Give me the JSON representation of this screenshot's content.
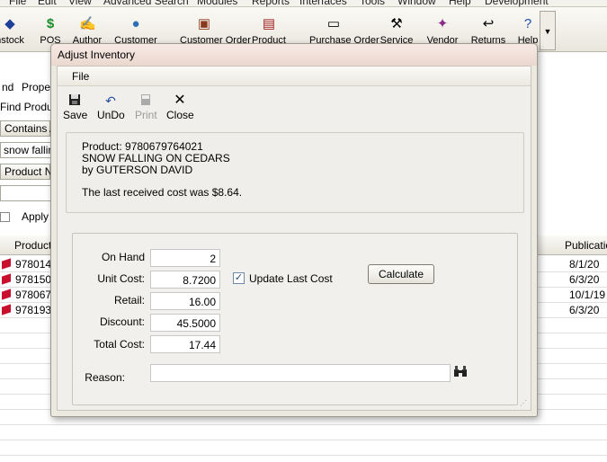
{
  "background_app": {
    "menu": [
      "File",
      "Edit",
      "View",
      "Advanced Search",
      "Modules",
      "Reports",
      "Interfaces",
      "Tools",
      "Window",
      "Help",
      "Development"
    ],
    "toolbar": [
      {
        "label": "nstock",
        "icon": "inventory-icon"
      },
      {
        "label": "POS",
        "icon": "dollar-icon"
      },
      {
        "label": "Author",
        "icon": "author-icon"
      },
      {
        "label": "Customer",
        "icon": "globe-icon"
      },
      {
        "label": "Customer Order",
        "icon": "customer-order-icon"
      },
      {
        "label": "Product",
        "icon": "product-icon"
      },
      {
        "label": "Purchase Order",
        "icon": "purchase-order-icon"
      },
      {
        "label": "Service",
        "icon": "wrench-icon"
      },
      {
        "label": "Vendor",
        "icon": "vendor-icon"
      },
      {
        "label": "Returns",
        "icon": "returns-icon"
      },
      {
        "label": "Help",
        "icon": "help-icon"
      }
    ],
    "left_panel": {
      "row1_a": "nd",
      "row1_b": "Proper",
      "find_label": "Find Produc",
      "contains_btn": "Contains Al",
      "search_text": "snow falling",
      "product_num_btn": "Product Nu",
      "apply_label": "Apply"
    },
    "grid": {
      "col_product": "Product",
      "col_publication": "Publication",
      "rows": [
        {
          "code": "978014",
          "date": "8/1/20"
        },
        {
          "code": "978150",
          "date": "6/3/20"
        },
        {
          "code": "978067",
          "date": "10/1/19"
        },
        {
          "code": "978193",
          "date": "6/3/20"
        }
      ]
    }
  },
  "dialog": {
    "title": "Adjust Inventory",
    "menu_file": "File",
    "toolbar": {
      "save": "Save",
      "undo": "UnDo",
      "print": "Print",
      "close": "Close"
    },
    "product_info": {
      "product_line": "Product: 9780679764021",
      "title_line": "SNOW FALLING ON CEDARS",
      "author_line": "by  GUTERSON DAVID",
      "cost_line": "The last received cost was $8.64."
    },
    "form": {
      "on_hand_label": "On Hand",
      "on_hand_value": "2",
      "unit_cost_label": "Unit Cost:",
      "unit_cost_value": "8.7200",
      "update_last_cost_label": "Update Last Cost",
      "update_last_cost_checked": true,
      "calculate_label": "Calculate",
      "retail_label": "Retail:",
      "retail_value": "16.00",
      "discount_label": "Discount:",
      "discount_value": "45.5000",
      "total_cost_label": "Total Cost:",
      "total_cost_value": "17.44",
      "reason_label": "Reason:",
      "reason_value": ""
    }
  }
}
